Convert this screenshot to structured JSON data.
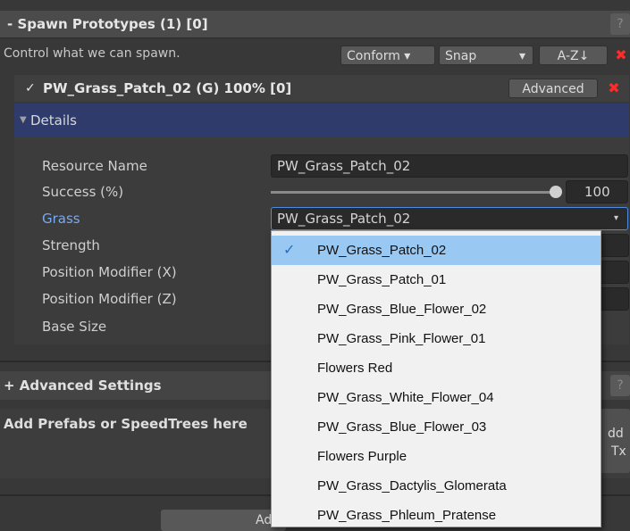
{
  "header": {
    "title": "- Spawn Prototypes (1) [0]",
    "help": "?"
  },
  "toolbar": {
    "description": "Control what we can spawn.",
    "conform": "Conform ▾",
    "snap": "Snap",
    "snap_arrow": "▾",
    "sort": "A-Z↓",
    "remove": "✖"
  },
  "prototype": {
    "checkbox": "✓",
    "title": "PW_Grass_Patch_02 (G) 100% [0]",
    "advanced": "Advanced",
    "remove": "✖"
  },
  "details": {
    "arrow": "▼",
    "label": "Details"
  },
  "fields": {
    "resource_name_label": "Resource Name",
    "resource_name_value": "PW_Grass_Patch_02",
    "success_label": "Success (%)",
    "success_value": "100",
    "success_fraction": 1.0,
    "grass_label": "Grass",
    "grass_value": "PW_Grass_Patch_02",
    "grass_arrow": "▾",
    "strength_label": "Strength",
    "pos_x_label": "Position Modifier (X)",
    "pos_z_label": "Position Modifier (Z)",
    "base_size_label": "Base Size"
  },
  "advanced_settings": {
    "title": "+ Advanced Settings",
    "help": "?"
  },
  "prefabs": {
    "text": "Add Prefabs or SpeedTrees here",
    "side_top": "dd",
    "side_bottom": "Tx"
  },
  "footer": {
    "add_button_partial": "Ad"
  },
  "dropdown_popup": {
    "check": "✓",
    "items": [
      "PW_Grass_Patch_02",
      "PW_Grass_Patch_01",
      "PW_Grass_Blue_Flower_02",
      "PW_Grass_Pink_Flower_01",
      "Flowers Red",
      "PW_Grass_White_Flower_04",
      "PW_Grass_Blue_Flower_03",
      "Flowers Purple",
      "PW_Grass_Dactylis_Glomerata",
      "PW_Grass_Phleum_Pratense"
    ]
  }
}
